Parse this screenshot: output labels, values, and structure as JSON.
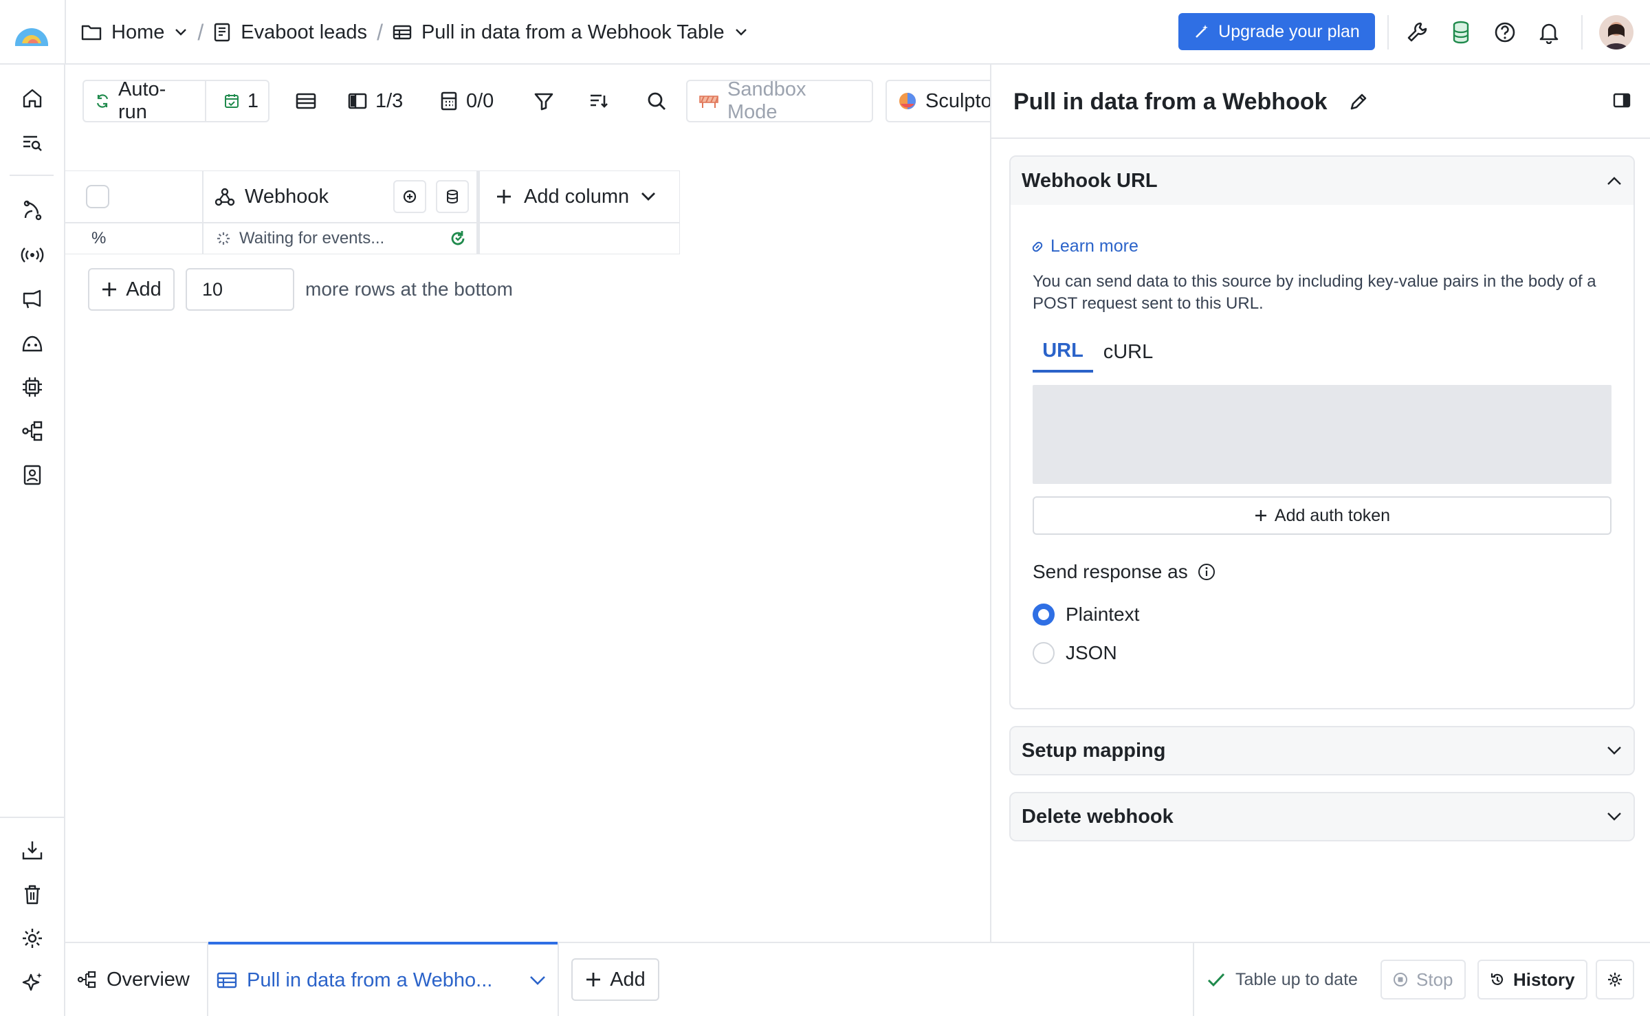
{
  "breadcrumb": {
    "home": "Home",
    "workbook": "Evaboot leads",
    "table": "Pull in data from a Webhook Table"
  },
  "header": {
    "upgrade_label": "Upgrade your plan"
  },
  "toolbar": {
    "autorun_label": "Auto-run",
    "autorun_count": "1",
    "views_count": "1/3",
    "calc_count": "0/0",
    "sandbox_label": "Sandbox Mode",
    "sculptor_label": "Sculptor"
  },
  "grid": {
    "row_marker": "%",
    "column_name": "Webhook",
    "cell_status": "Waiting for events...",
    "add_column_label": "Add column",
    "add_rows_label": "Add",
    "add_rows_value": "10",
    "add_rows_suffix": "more rows at the bottom"
  },
  "panel": {
    "title": "Pull in data from a Webhook",
    "webhook_section": {
      "title": "Webhook URL",
      "learn_more": "Learn more",
      "description": "You can send data to this source by including key-value pairs in the body of a POST request sent to this URL.",
      "tabs": [
        "URL",
        "cURL"
      ],
      "active_tab": "URL",
      "add_auth_label": "Add auth token",
      "response_label": "Send response as",
      "options": [
        "Plaintext",
        "JSON"
      ],
      "selected_option": "Plaintext"
    },
    "setup_mapping": "Setup mapping",
    "delete_webhook": "Delete webhook"
  },
  "bottombar": {
    "overview_label": "Overview",
    "active_tab_label": "Pull in data from a Webho...",
    "add_label": "Add",
    "status_label": "Table up to date",
    "stop_label": "Stop",
    "history_label": "History"
  },
  "colors": {
    "accent": "#2f6fe4",
    "link": "#2b63c9",
    "success": "#1f8a4c"
  }
}
